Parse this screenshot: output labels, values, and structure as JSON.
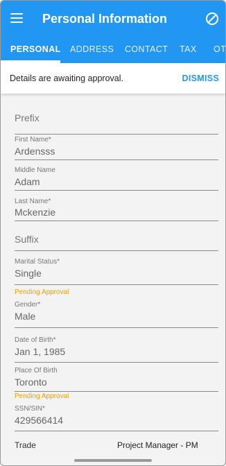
{
  "header": {
    "title": "Personal Information",
    "menu_icon": "hamburger-menu-icon",
    "action_icon": "block-icon"
  },
  "tabs": [
    {
      "label": "PERSONAL",
      "active": true
    },
    {
      "label": "ADDRESS",
      "active": false
    },
    {
      "label": "CONTACT",
      "active": false
    },
    {
      "label": "TAX",
      "active": false
    },
    {
      "label": "OTI",
      "active": false
    }
  ],
  "banner": {
    "text": "Details are awaiting approval.",
    "dismiss_label": "DISMISS"
  },
  "form": {
    "prefix": {
      "placeholder": "Prefix"
    },
    "first_name": {
      "label": "First Name*",
      "value": "Ardensss"
    },
    "middle_name": {
      "label": "Middle Name",
      "value": "Adam"
    },
    "last_name": {
      "label": "Last Name*",
      "value": "Mckenzie"
    },
    "suffix": {
      "placeholder": "Suffix"
    },
    "marital_status": {
      "label": "Marital Status*",
      "value": "Single"
    },
    "gender": {
      "status": "Pending Approval",
      "label": "Gender*",
      "value": "Male"
    },
    "date_of_birth": {
      "label": "Date of Birth*",
      "value": "Jan 1, 1985"
    },
    "place_of_birth": {
      "label": "Place Of Birth",
      "value": "Toronto"
    },
    "ssn": {
      "status": "Pending Approval",
      "label": "SSN/SIN*",
      "value": "429566414"
    },
    "trade": {
      "label": "Trade",
      "value": "Project Manager - PM"
    }
  },
  "colors": {
    "primary": "#2196f3",
    "pending": "#f0a000",
    "background": "#f3f3f3"
  }
}
